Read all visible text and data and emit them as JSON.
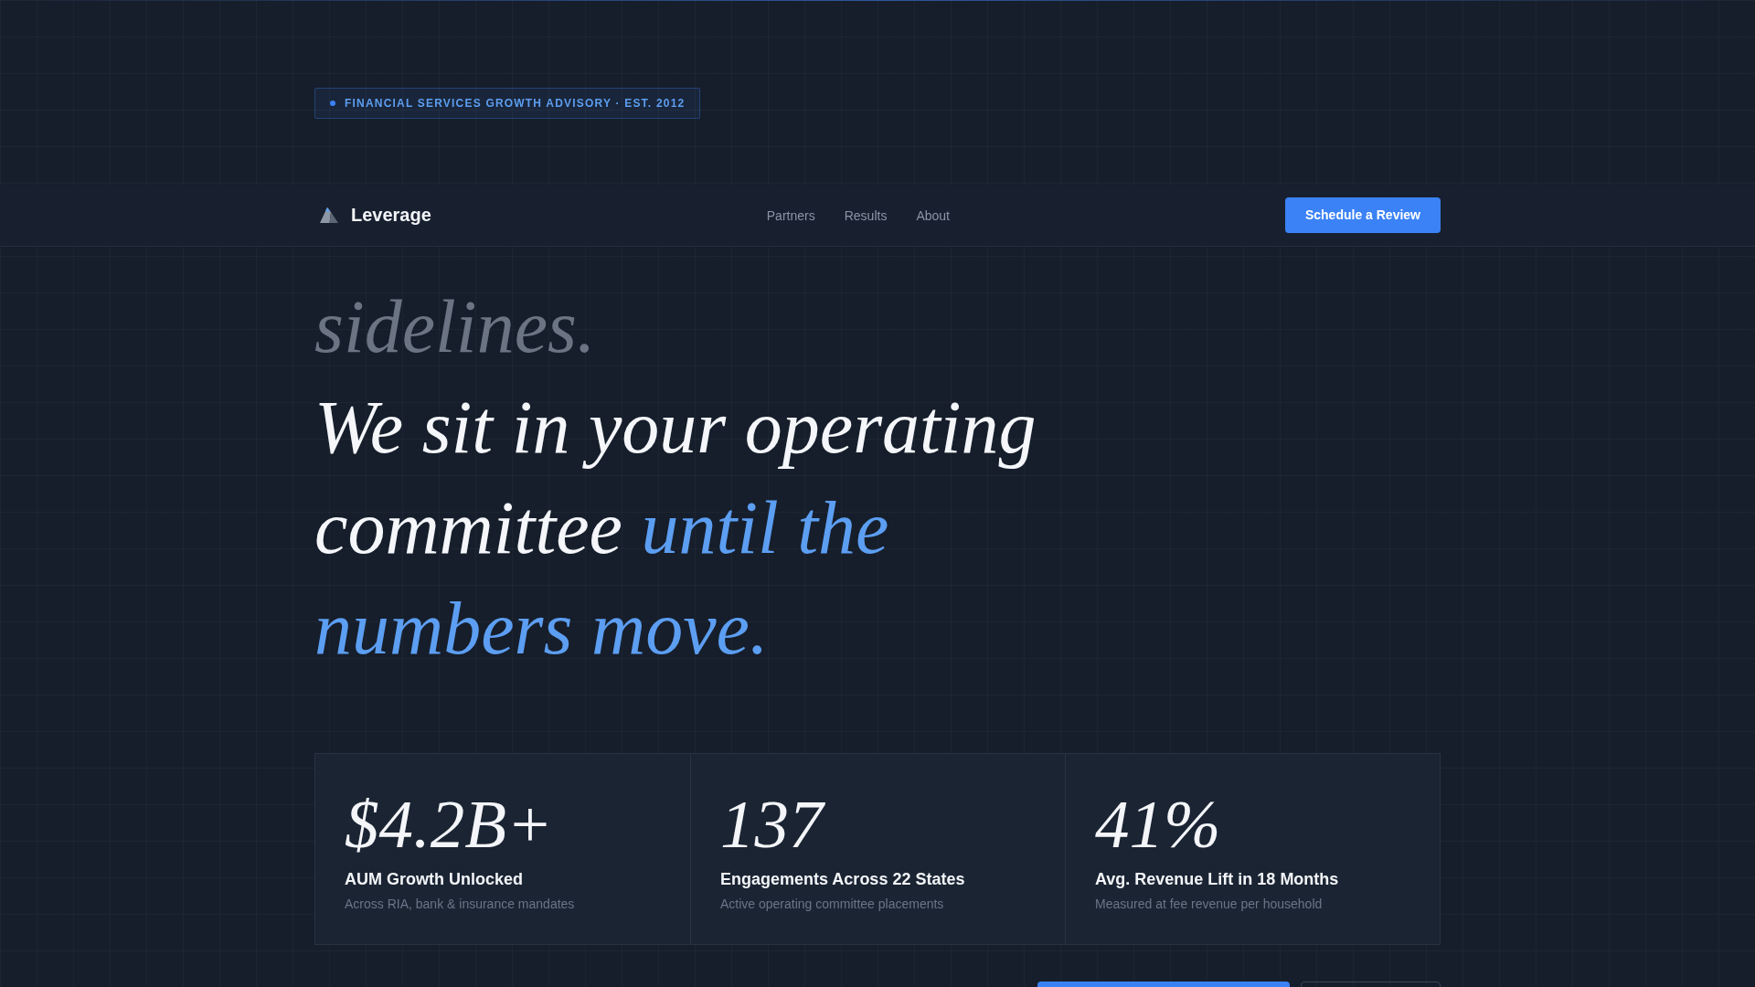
{
  "badge": {
    "text": "FINANCIAL SERVICES GROWTH ADVISORY · EST. 2012"
  },
  "nav": {
    "brand": "Leverage",
    "links": [
      {
        "label": "Partners"
      },
      {
        "label": "Results"
      },
      {
        "label": "About"
      }
    ],
    "button": "Schedule a Review"
  },
  "headline": [
    {
      "segments": [
        {
          "text": "sidelines.",
          "kind": "muted"
        }
      ]
    },
    {
      "segments": [
        {
          "text": "We sit in your operating committee",
          "kind": "plain"
        },
        {
          "text": "until the numbers move.",
          "kind": "accent"
        }
      ]
    }
  ],
  "stats": [
    {
      "value": "$4.2B+",
      "label": "AUM Growth Unlocked",
      "note": "Across RIA, bank & insurance mandates"
    },
    {
      "value": "137",
      "label": "Engagements Across 22 States",
      "note": "Active operating committee placements"
    },
    {
      "value": "41%",
      "label": "Avg. Revenue Lift in 18 Months",
      "note": "Measured at fee revenue per household"
    }
  ]
}
